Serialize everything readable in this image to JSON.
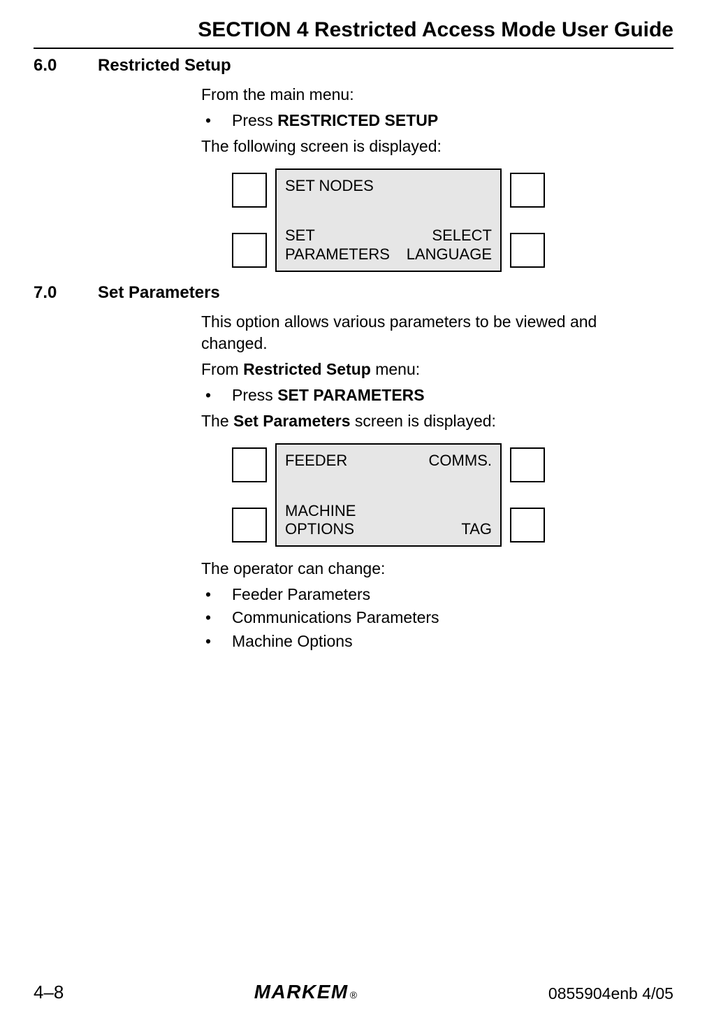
{
  "header": {
    "title": "SECTION 4 Restricted Access Mode User Guide"
  },
  "sections": [
    {
      "number": "6.0",
      "title": "Restricted Setup",
      "intro": {
        "line1": "From the main menu:",
        "bullet1_prefix": "Press ",
        "bullet1_bold": "RESTRICTED SETUP",
        "line2": "The following screen is displayed:"
      },
      "screen": {
        "tl": "SET NODES",
        "bl": "SET\nPARAMETERS",
        "br": "SELECT\nLANGUAGE"
      }
    },
    {
      "number": "7.0",
      "title": "Set Parameters",
      "intro": {
        "line1": "This option allows various parameters to be viewed and changed.",
        "line2_prefix": "From ",
        "line2_bold": "Restricted Setup",
        "line2_suffix": " menu:",
        "bullet1_prefix": "Press ",
        "bullet1_bold": "SET PARAMETERS",
        "line3_prefix": "The ",
        "line3_bold": "Set Parameters",
        "line3_suffix": " screen is displayed:"
      },
      "screen": {
        "tl": "FEEDER",
        "tr": "COMMS.",
        "bl": "MACHINE\nOPTIONS",
        "br": "TAG"
      },
      "after": {
        "line1": "The operator can change:",
        "bullets": [
          "Feeder Parameters",
          "Communications Parameters",
          "Machine Options"
        ]
      }
    }
  ],
  "footer": {
    "left": "4–8",
    "center": "MARKEM",
    "reg": "®",
    "right": "0855904enb 4/05"
  }
}
